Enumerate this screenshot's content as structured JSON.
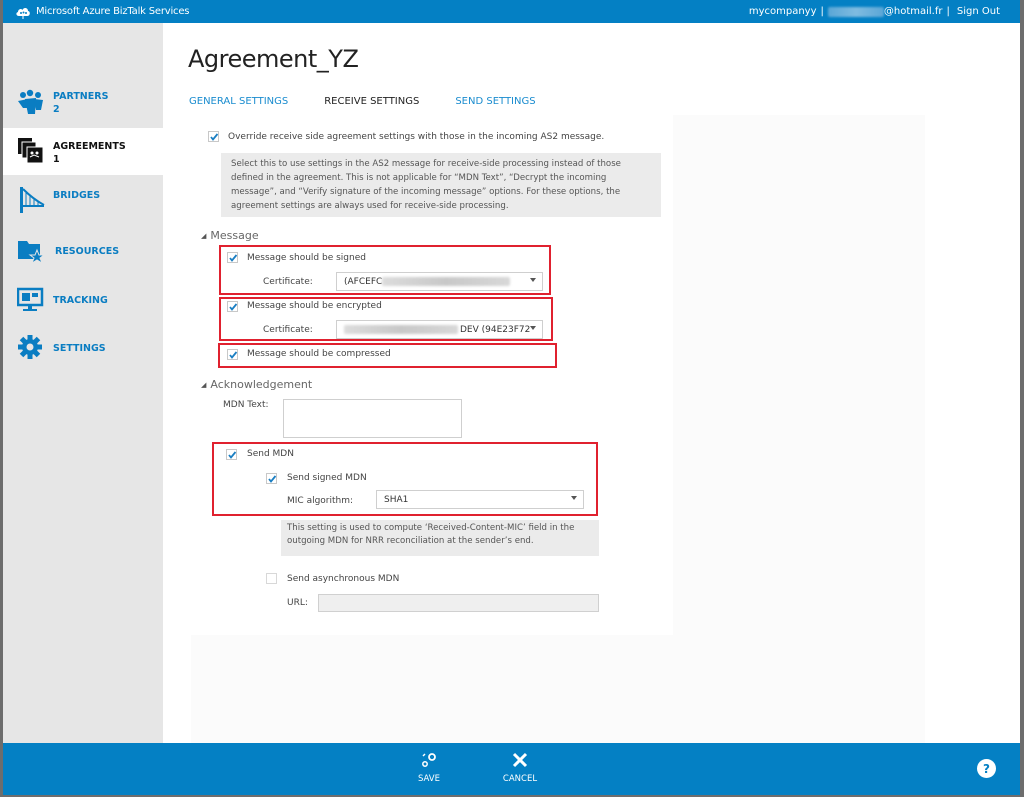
{
  "topbar": {
    "app_title": "Microsoft Azure BizTalk Services",
    "account": "mycompanyy",
    "separator": "|",
    "email_suffix": "@hotmail.fr",
    "sign_out": "Sign Out",
    "logo_icon": "cloud-people-icon"
  },
  "sidebar": {
    "items": [
      {
        "label": "PARTNERS",
        "count": "2",
        "icon": "partners-icon",
        "active": false
      },
      {
        "label": "AGREEMENTS",
        "count": "1",
        "icon": "agreements-icon",
        "active": true
      },
      {
        "label": "BRIDGES",
        "count": "",
        "icon": "bridge-icon",
        "active": false
      },
      {
        "label": "RESOURCES",
        "count": "",
        "icon": "resources-icon",
        "active": false
      },
      {
        "label": "TRACKING",
        "count": "",
        "icon": "tracking-icon",
        "active": false
      },
      {
        "label": "SETTINGS",
        "count": "",
        "icon": "gear-icon",
        "active": false
      }
    ]
  },
  "main": {
    "title": "Agreement_YZ",
    "tabs": [
      {
        "label": "GENERAL SETTINGS",
        "active": false
      },
      {
        "label": "RECEIVE SETTINGS",
        "active": true
      },
      {
        "label": "SEND SETTINGS",
        "active": false
      }
    ],
    "override": {
      "checked": true,
      "label": "Override receive side agreement settings with those in the incoming AS2 message.",
      "info": "Select this to use settings in the AS2 message for receive-side processing instead of those defined in the agreement. This is not applicable for “MDN Text”, “Decrypt the incoming message”, and “Verify signature of the incoming message” options. For these options, the agreement settings are always used for receive-side processing."
    },
    "message": {
      "heading": "Message",
      "signed": {
        "checked": true,
        "label": "Message should be signed",
        "cert_label": "Certificate:",
        "cert_value": "(AFCEFC"
      },
      "encrypted": {
        "checked": true,
        "label": "Message should be encrypted",
        "cert_label": "Certificate:",
        "cert_value": "DEV (94E23F72"
      },
      "compressed": {
        "checked": true,
        "label": "Message should be compressed"
      }
    },
    "acknowledgement": {
      "heading": "Acknowledgement",
      "mdn_text_label": "MDN Text:",
      "mdn_text_value": "",
      "send_mdn": {
        "checked": true,
        "label": "Send MDN"
      },
      "send_signed_mdn": {
        "checked": true,
        "label": "Send signed MDN"
      },
      "mic_label": "MIC algorithm:",
      "mic_value": "SHA1",
      "mic_info": "This setting is used to compute ‘Received-Content-MIC’ field in the outgoing MDN for NRR reconciliation at the sender’s end.",
      "send_async_mdn": {
        "checked": false,
        "label": "Send asynchronous MDN"
      },
      "url_label": "URL:",
      "url_value": ""
    }
  },
  "bottombar": {
    "save": "SAVE",
    "cancel": "CANCEL",
    "help": "?"
  },
  "colors": {
    "brand": "#0480c4",
    "link": "#1a8ccf",
    "highlight": "#e0212f",
    "sidebar_bg": "#e6e6e6"
  }
}
